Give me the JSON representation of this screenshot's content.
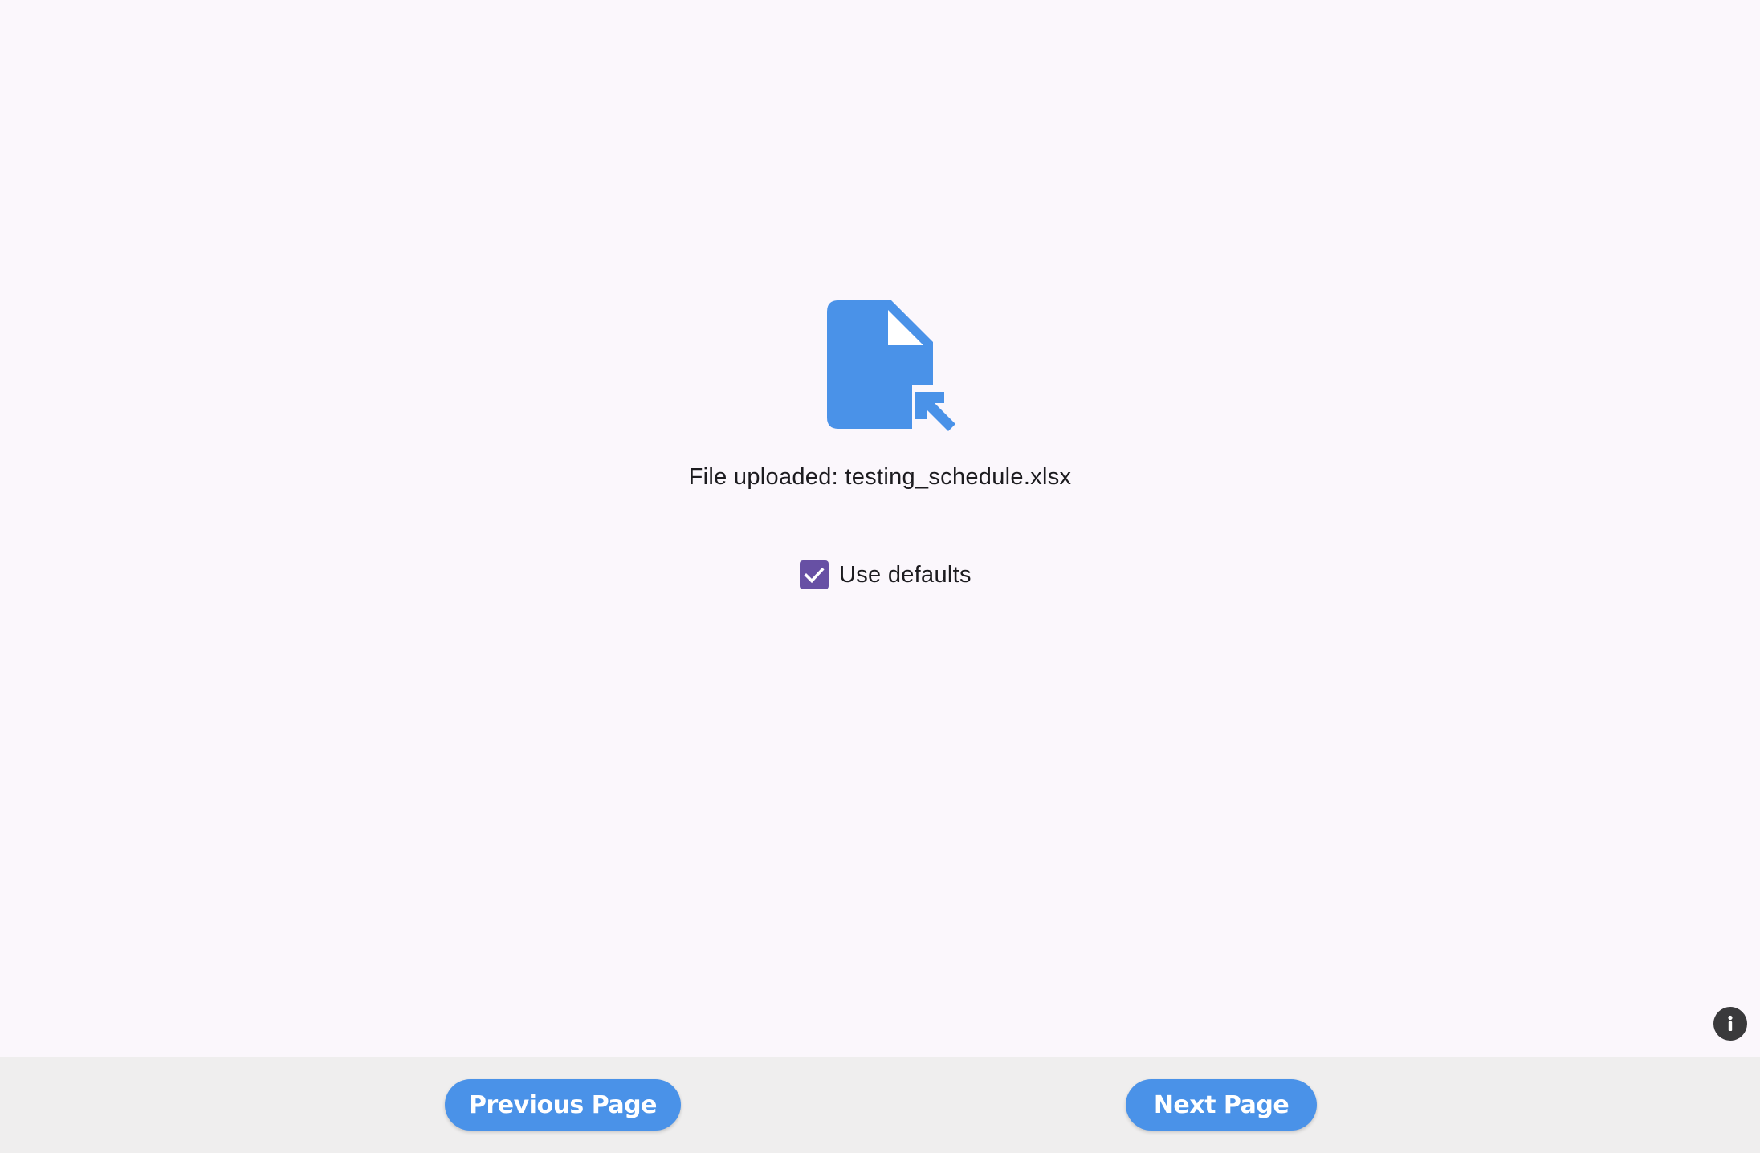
{
  "upload": {
    "icon": "file-upload-icon",
    "status_text": "File uploaded: testing_schedule.xlsx"
  },
  "options": {
    "use_defaults_label": "Use defaults",
    "use_defaults_checked": true
  },
  "info": {
    "icon": "info-icon"
  },
  "navigation": {
    "previous_label": "Previous Page",
    "next_label": "Next Page"
  },
  "colors": {
    "background": "#fbf7fc",
    "accent": "#4a92e8",
    "checkbox": "#6750a4",
    "bottom_bar": "#efeeee"
  }
}
